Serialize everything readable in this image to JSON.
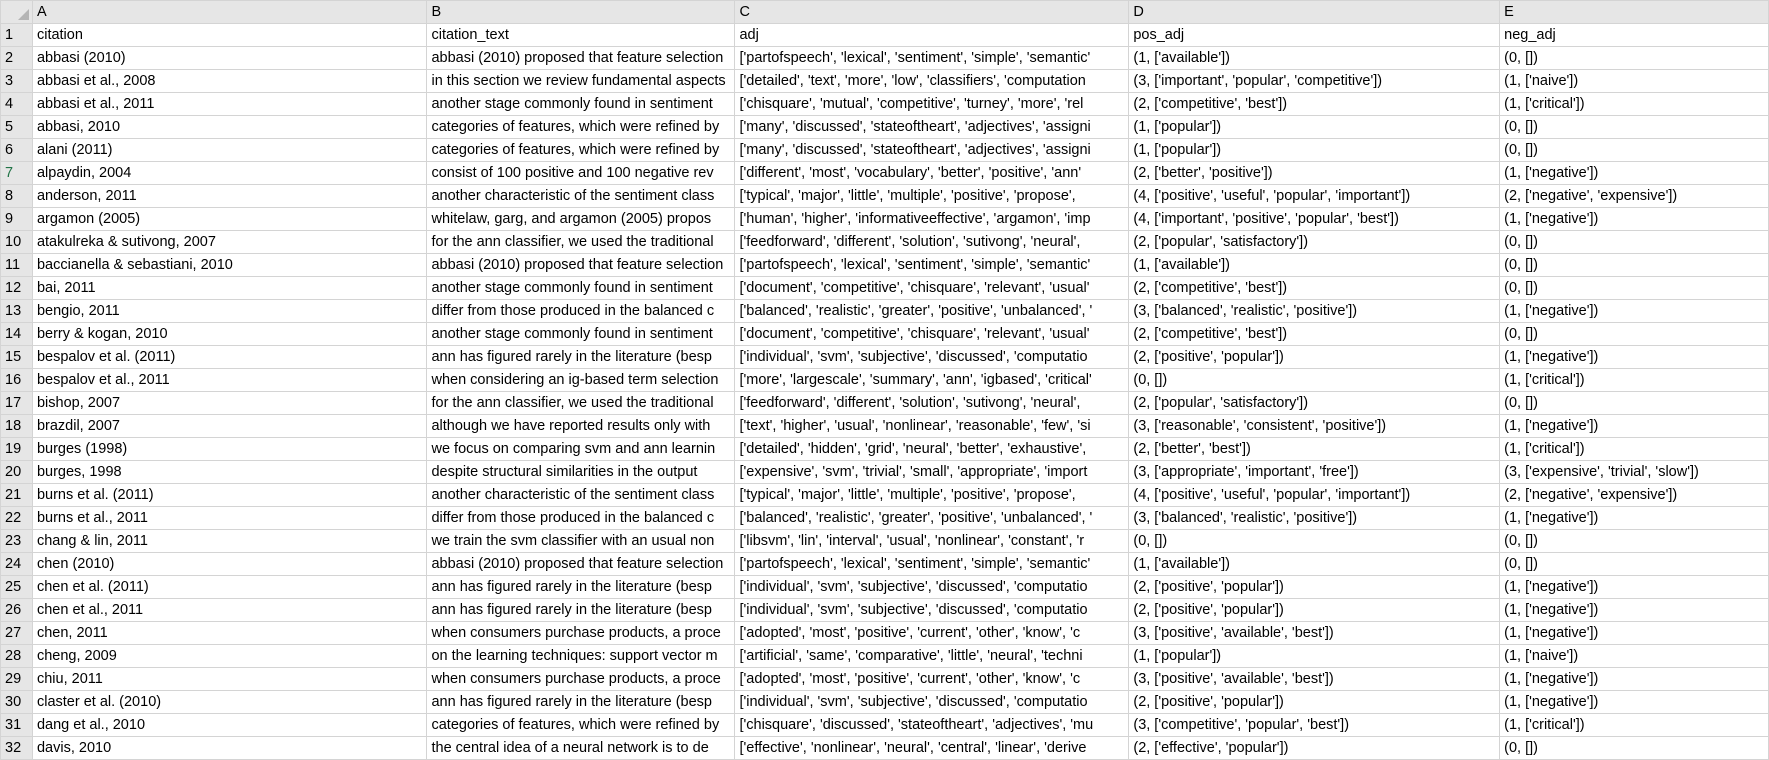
{
  "columns": [
    "A",
    "B",
    "C",
    "D",
    "E"
  ],
  "rows": [
    {
      "n": "1",
      "cells": [
        "citation",
        "citation_text",
        "adj",
        "pos_adj",
        "neg_adj"
      ]
    },
    {
      "n": "2",
      "cells": [
        "abbasi (2010)",
        "abbasi (2010) proposed that feature selection",
        "['partofspeech', 'lexical', 'sentiment', 'simple', 'semantic'",
        "(1, ['available'])",
        "(0, [])"
      ]
    },
    {
      "n": "3",
      "cells": [
        "abbasi et al., 2008",
        "in this section we review fundamental aspects",
        "['detailed', 'text', 'more', 'low', 'classifiers', 'computation",
        "(3, ['important', 'popular', 'competitive'])",
        "(1, ['naive'])"
      ]
    },
    {
      "n": "4",
      "cells": [
        "abbasi et al., 2011",
        "another stage commonly found in sentiment",
        "['chisquare', 'mutual', 'competitive', 'turney', 'more', 'rel",
        "(2, ['competitive', 'best'])",
        "(1, ['critical'])"
      ]
    },
    {
      "n": "5",
      "cells": [
        "abbasi, 2010",
        "categories of features, which were refined by",
        "['many', 'discussed', 'stateoftheart', 'adjectives', 'assigni",
        "(1, ['popular'])",
        "(0, [])"
      ]
    },
    {
      "n": "6",
      "cells": [
        "alani (2011)",
        "categories of features, which were refined by",
        "['many', 'discussed', 'stateoftheart', 'adjectives', 'assigni",
        "(1, ['popular'])",
        "(0, [])"
      ]
    },
    {
      "n": "7",
      "cells": [
        "alpaydin, 2004",
        "consist of 100 positive and 100 negative rev",
        "['different', 'most', 'vocabulary', 'better', 'positive', 'ann'",
        "(2, ['better', 'positive'])",
        "(1, ['negative'])"
      ]
    },
    {
      "n": "8",
      "cells": [
        "anderson, 2011",
        "another characteristic of the sentiment class",
        "['typical', 'major', 'little', 'multiple', 'positive', 'propose',",
        "(4, ['positive', 'useful', 'popular', 'important'])",
        "(2, ['negative', 'expensive'])"
      ]
    },
    {
      "n": "9",
      "cells": [
        "argamon (2005)",
        "whitelaw, garg, and argamon (2005) propos",
        "['human', 'higher', 'informativeeffective', 'argamon', 'imp",
        "(4, ['important', 'positive', 'popular', 'best'])",
        "(1, ['negative'])"
      ]
    },
    {
      "n": "10",
      "cells": [
        "atakulreka & sutivong, 2007",
        "for the ann classifier, we used the traditional",
        "['feedforward', 'different', 'solution', 'sutivong', 'neural',",
        "(2, ['popular', 'satisfactory'])",
        "(0, [])"
      ]
    },
    {
      "n": "11",
      "cells": [
        "baccianella & sebastiani, 2010",
        "abbasi (2010) proposed that feature selection",
        "['partofspeech', 'lexical', 'sentiment', 'simple', 'semantic'",
        "(1, ['available'])",
        "(0, [])"
      ]
    },
    {
      "n": "12",
      "cells": [
        "bai, 2011",
        "another stage commonly found in sentiment",
        "['document', 'competitive', 'chisquare', 'relevant', 'usual'",
        "(2, ['competitive', 'best'])",
        "(0, [])"
      ]
    },
    {
      "n": "13",
      "cells": [
        "bengio, 2011",
        "differ from those produced in the balanced c",
        "['balanced', 'realistic', 'greater', 'positive', 'unbalanced', '",
        "(3, ['balanced', 'realistic', 'positive'])",
        "(1, ['negative'])"
      ]
    },
    {
      "n": "14",
      "cells": [
        "berry & kogan, 2010",
        "another stage commonly found in sentiment",
        "['document', 'competitive', 'chisquare', 'relevant', 'usual'",
        "(2, ['competitive', 'best'])",
        "(0, [])"
      ]
    },
    {
      "n": "15",
      "cells": [
        "bespalov et al. (2011)",
        "ann has figured rarely in the literature (besp",
        "['individual', 'svm', 'subjective', 'discussed', 'computatio",
        "(2, ['positive', 'popular'])",
        "(1, ['negative'])"
      ]
    },
    {
      "n": "16",
      "cells": [
        "bespalov et al., 2011",
        "when considering an ig-based term selection",
        "['more', 'largescale', 'summary', 'ann', 'igbased', 'critical'",
        "(0, [])",
        "(1, ['critical'])"
      ]
    },
    {
      "n": "17",
      "cells": [
        "bishop, 2007",
        "for the ann classifier, we used the traditional",
        "['feedforward', 'different', 'solution', 'sutivong', 'neural',",
        "(2, ['popular', 'satisfactory'])",
        "(0, [])"
      ]
    },
    {
      "n": "18",
      "cells": [
        "brazdil, 2007",
        "although we have reported results only with",
        "['text', 'higher', 'usual', 'nonlinear', 'reasonable', 'few', 'si",
        "(3, ['reasonable', 'consistent', 'positive'])",
        "(1, ['negative'])"
      ]
    },
    {
      "n": "19",
      "cells": [
        "burges (1998)",
        "we focus on comparing svm and ann learnin",
        "['detailed', 'hidden', 'grid', 'neural', 'better', 'exhaustive',",
        "(2, ['better', 'best'])",
        "(1, ['critical'])"
      ]
    },
    {
      "n": "20",
      "cells": [
        "burges, 1998",
        "despite structural similarities in the output",
        "['expensive', 'svm', 'trivial', 'small', 'appropriate', 'import",
        "(3, ['appropriate', 'important', 'free'])",
        "(3, ['expensive', 'trivial', 'slow'])"
      ]
    },
    {
      "n": "21",
      "cells": [
        "burns et al. (2011)",
        "another characteristic of the sentiment class",
        "['typical', 'major', 'little', 'multiple', 'positive', 'propose',",
        "(4, ['positive', 'useful', 'popular', 'important'])",
        "(2, ['negative', 'expensive'])"
      ]
    },
    {
      "n": "22",
      "cells": [
        "burns et al., 2011",
        "differ from those produced in the balanced c",
        "['balanced', 'realistic', 'greater', 'positive', 'unbalanced', '",
        "(3, ['balanced', 'realistic', 'positive'])",
        "(1, ['negative'])"
      ]
    },
    {
      "n": "23",
      "cells": [
        "chang & lin, 2011",
        "we train the svm classifier with an usual non",
        "['libsvm', 'lin', 'interval', 'usual', 'nonlinear', 'constant', 'r",
        "(0, [])",
        "(0, [])"
      ]
    },
    {
      "n": "24",
      "cells": [
        "chen (2010)",
        "abbasi (2010) proposed that feature selection",
        "['partofspeech', 'lexical', 'sentiment', 'simple', 'semantic'",
        "(1, ['available'])",
        "(0, [])"
      ]
    },
    {
      "n": "25",
      "cells": [
        "chen et al. (2011)",
        "ann has figured rarely in the literature (besp",
        "['individual', 'svm', 'subjective', 'discussed', 'computatio",
        "(2, ['positive', 'popular'])",
        "(1, ['negative'])"
      ]
    },
    {
      "n": "26",
      "cells": [
        "chen et al., 2011",
        "ann has figured rarely in the literature (besp",
        "['individual', 'svm', 'subjective', 'discussed', 'computatio",
        "(2, ['positive', 'popular'])",
        "(1, ['negative'])"
      ]
    },
    {
      "n": "27",
      "cells": [
        "chen, 2011",
        "when consumers purchase products, a proce",
        "['adopted', 'most', 'positive', 'current', 'other', 'know', 'c",
        "(3, ['positive', 'available', 'best'])",
        "(1, ['negative'])"
      ]
    },
    {
      "n": "28",
      "cells": [
        "cheng, 2009",
        "on the learning techniques: support vector m",
        "['artificial', 'same', 'comparative', 'little', 'neural', 'techni",
        "(1, ['popular'])",
        "(1, ['naive'])"
      ]
    },
    {
      "n": "29",
      "cells": [
        "chiu, 2011",
        "when consumers purchase products, a proce",
        "['adopted', 'most', 'positive', 'current', 'other', 'know', 'c",
        "(3, ['positive', 'available', 'best'])",
        "(1, ['negative'])"
      ]
    },
    {
      "n": "30",
      "cells": [
        "claster et al. (2010)",
        "ann has figured rarely in the literature (besp",
        "['individual', 'svm', 'subjective', 'discussed', 'computatio",
        "(2, ['positive', 'popular'])",
        "(1, ['negative'])"
      ]
    },
    {
      "n": "31",
      "cells": [
        "dang et al., 2010",
        "categories of features, which were refined by",
        "['chisquare', 'discussed', 'stateoftheart', 'adjectives', 'mu",
        "(3, ['competitive', 'popular', 'best'])",
        "(1, ['critical'])"
      ]
    },
    {
      "n": "32",
      "cells": [
        "davis, 2010",
        "the central idea of a neural network is to de",
        "['effective', 'nonlinear', 'neural', 'central', 'linear', 'derive",
        "(2, ['effective', 'popular'])",
        "(0, [])"
      ]
    }
  ],
  "selected_row": "7"
}
